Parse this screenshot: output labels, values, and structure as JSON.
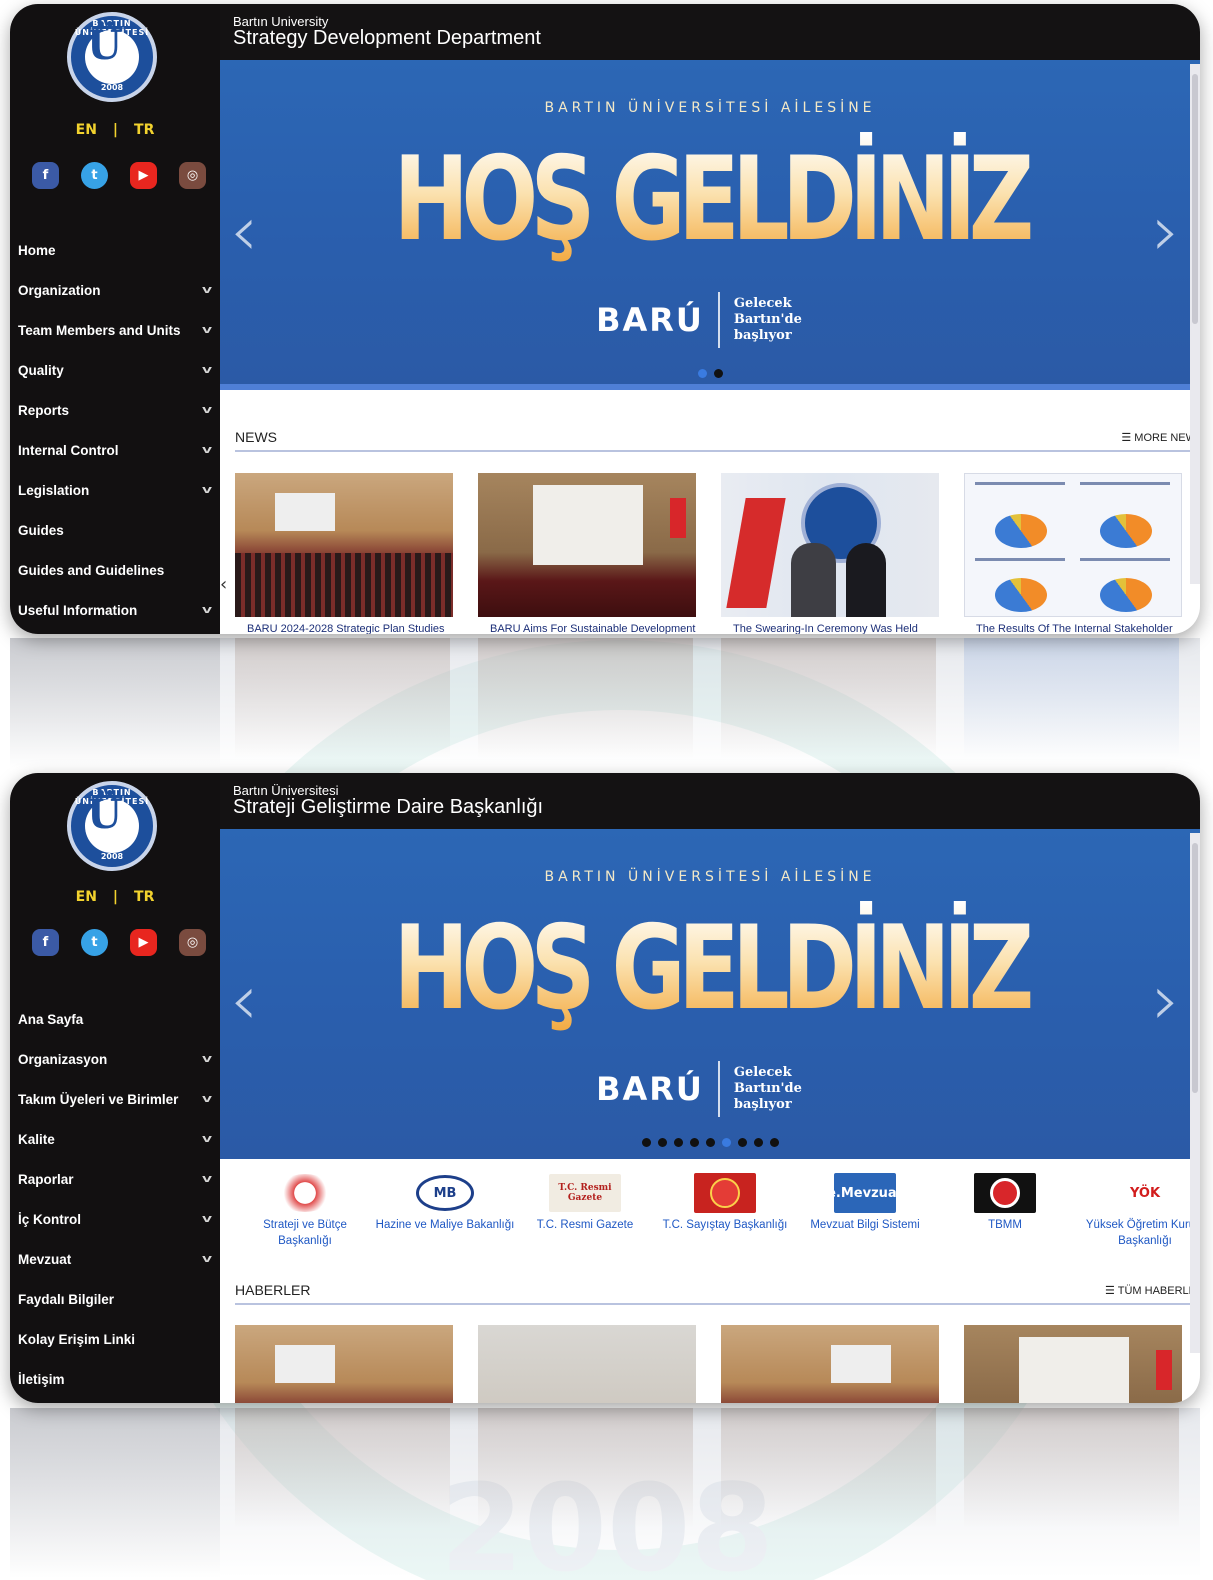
{
  "background": {
    "year": "2008"
  },
  "panel_en": {
    "logo": {
      "arc_text": "BARTIN ÜNİVERSİTESİ",
      "year": "2008"
    },
    "lang": {
      "en": "EN",
      "sep": "|",
      "tr": "TR"
    },
    "social": [
      "facebook-icon",
      "twitter-icon",
      "youtube-icon",
      "instagram-icon"
    ],
    "header": {
      "small": "Bartın University",
      "big": "Strategy Development Department"
    },
    "menu": [
      {
        "label": "Home",
        "chevron": false
      },
      {
        "label": "Organization",
        "chevron": true
      },
      {
        "label": "Team Members and Units",
        "chevron": true
      },
      {
        "label": "Quality",
        "chevron": true
      },
      {
        "label": "Reports",
        "chevron": true
      },
      {
        "label": "Internal Control",
        "chevron": true
      },
      {
        "label": "Legislation",
        "chevron": true
      },
      {
        "label": "Guides",
        "chevron": false
      },
      {
        "label": "Guides and Guidelines",
        "chevron": false
      },
      {
        "label": "Useful Information",
        "chevron": true
      }
    ],
    "slider": {
      "subtitle": "BARTIN ÜNİVERSİTESİ AİLESİNE",
      "headline": "HOŞ GELDİNİZ",
      "brand_left": "BARÚ",
      "brand_right": "Gelecek Bartın'de başlıyor",
      "prev": "‹",
      "next": "›",
      "dots": 2,
      "active_dot": 0
    },
    "news": {
      "title": "NEWS",
      "more": "☰ MORE NEW",
      "items": [
        "BARU 2024-2028 Strategic Plan Studies",
        "BARU Aims For Sustainable Development",
        "The Swearing-In Ceremony Was Held",
        "The Results Of The Internal Stakeholder"
      ]
    }
  },
  "panel_tr": {
    "logo": {
      "arc_text": "BARTIN ÜNİVERSİTESİ",
      "year": "2008"
    },
    "lang": {
      "en": "EN",
      "sep": "|",
      "tr": "TR"
    },
    "header": {
      "small": "Bartın Üniversitesi",
      "big": "Strateji Geliştirme Daire Başkanlığı"
    },
    "menu": [
      {
        "label": "Ana Sayfa",
        "chevron": false
      },
      {
        "label": "Organizasyon",
        "chevron": true
      },
      {
        "label": "Takım Üyeleri ve Birimler",
        "chevron": true
      },
      {
        "label": "Kalite",
        "chevron": true
      },
      {
        "label": "Raporlar",
        "chevron": true
      },
      {
        "label": "İç Kontrol",
        "chevron": true
      },
      {
        "label": "Mevzuat",
        "chevron": true
      },
      {
        "label": "Faydalı Bilgiler",
        "chevron": false
      },
      {
        "label": "Kolay Erişim Linki",
        "chevron": false
      },
      {
        "label": "İletişim",
        "chevron": false
      }
    ],
    "slider": {
      "subtitle": "BARTIN ÜNİVERSİTESİ AİLESİNE",
      "headline": "HOŞ GELDİNİZ",
      "brand_left": "BARÚ",
      "brand_right": "Gelecek Bartın'de başlıyor",
      "prev": "‹",
      "next": "›",
      "dots": 9,
      "active_dot": 5
    },
    "links": [
      {
        "label": "Strateji ve Bütçe Başkanlığı",
        "icon": "sbb-logo-icon"
      },
      {
        "label": "Hazine ve Maliye Bakanlığı",
        "icon": "mb-logo-icon",
        "badge": "MB"
      },
      {
        "label": "T.C. Resmi Gazete",
        "icon": "resmi-gazete-icon",
        "badge": "T.C. Resmi Gazete"
      },
      {
        "label": "T.C. Sayıştay Başkanlığı",
        "icon": "sayistay-icon"
      },
      {
        "label": "Mevzuat Bilgi Sistemi",
        "icon": "mevzuat-icon",
        "badge": "e.Mevzuat"
      },
      {
        "label": "TBMM",
        "icon": "tbmm-icon"
      },
      {
        "label": "Yüksek Öğretim Kurulu Başkanlığı",
        "icon": "yok-icon",
        "badge": "YÖK"
      }
    ],
    "news": {
      "title": "HABERLER",
      "more": "☰ TÜM HABERLE"
    }
  },
  "colors": {
    "sidebar": "#121011",
    "accent_yellow": "#f2d22e",
    "slider_blue": "#2c67b5",
    "link_blue": "#1f58c4"
  }
}
